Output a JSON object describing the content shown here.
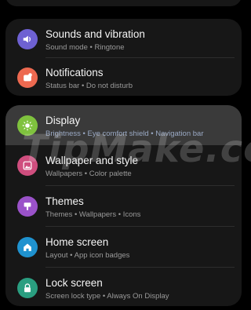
{
  "watermark": "TipMake.com",
  "groups": [
    {
      "items": [
        {
          "title": "Sounds and vibration",
          "subtitle": "Sound mode • Ringtone",
          "icon": "speaker-icon",
          "color": "#6e61d2"
        },
        {
          "title": "Notifications",
          "subtitle": "Status bar • Do not disturb",
          "icon": "notification-icon",
          "color": "#ed6950"
        }
      ]
    },
    {
      "items": [
        {
          "title": "Display",
          "subtitle": "Brightness • Eye comfort shield • Navigation bar",
          "icon": "sun-icon",
          "color": "#7fc23e",
          "highlighted": true
        },
        {
          "title": "Wallpaper and style",
          "subtitle": "Wallpapers • Color palette",
          "icon": "image-icon",
          "color": "#cf4e7e"
        },
        {
          "title": "Themes",
          "subtitle": "Themes • Wallpapers • Icons",
          "icon": "brush-icon",
          "color": "#9a52c9"
        },
        {
          "title": "Home screen",
          "subtitle": "Layout • App icon badges",
          "icon": "home-icon",
          "color": "#1f92cf"
        },
        {
          "title": "Lock screen",
          "subtitle": "Screen lock type • Always On Display",
          "icon": "lock-icon",
          "color": "#2a9e80"
        }
      ]
    }
  ]
}
